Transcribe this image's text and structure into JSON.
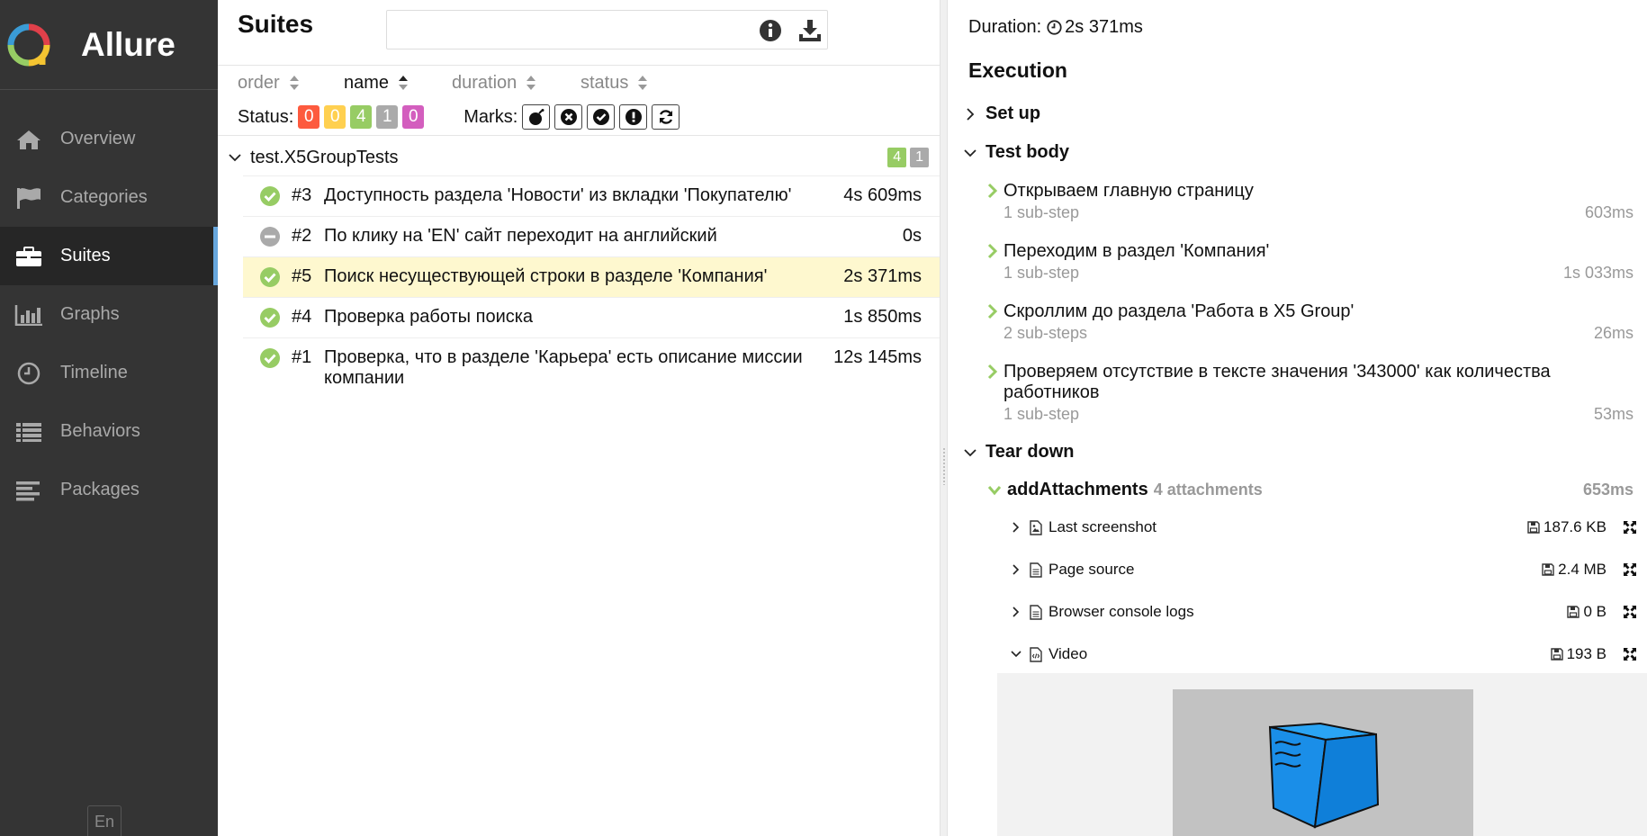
{
  "sidebar": {
    "brand": "Allure",
    "items": [
      {
        "label": "Overview",
        "icon": "home-icon"
      },
      {
        "label": "Categories",
        "icon": "flag-icon"
      },
      {
        "label": "Suites",
        "icon": "briefcase-icon",
        "active": true
      },
      {
        "label": "Graphs",
        "icon": "bar-chart-icon"
      },
      {
        "label": "Timeline",
        "icon": "clock-icon"
      },
      {
        "label": "Behaviors",
        "icon": "list-icon"
      },
      {
        "label": "Packages",
        "icon": "align-left-icon"
      }
    ],
    "language": "En"
  },
  "suites": {
    "title": "Suites",
    "search_placeholder": "",
    "sort": {
      "order": "order",
      "name": "name",
      "duration": "duration",
      "status": "status"
    },
    "status_label": "Status:",
    "status_counts": [
      {
        "value": "0",
        "color": "#fd5a3e"
      },
      {
        "value": "0",
        "color": "#ffd050"
      },
      {
        "value": "4",
        "color": "#97cc64"
      },
      {
        "value": "1",
        "color": "#aaaaaa"
      },
      {
        "value": "0",
        "color": "#d35ebe"
      }
    ],
    "marks_label": "Marks:",
    "marks": [
      "flaky-bomb-icon",
      "new-failed-icon",
      "new-passed-icon",
      "new-broken-icon",
      "retries-icon"
    ],
    "group": {
      "name": "test.X5GroupTests",
      "passed": "4",
      "skipped": "1"
    },
    "tests": [
      {
        "num": "#3",
        "name": "Доступность раздела 'Новости' из вкладки 'Покупателю'",
        "duration": "4s 609ms",
        "status": "passed"
      },
      {
        "num": "#2",
        "name": "По клику на 'EN' сайт переходит на английский",
        "duration": "0s",
        "status": "skipped"
      },
      {
        "num": "#5",
        "name": "Поиск несуществующей строки в разделе 'Компания'",
        "duration": "2s 371ms",
        "status": "passed",
        "selected": true
      },
      {
        "num": "#4",
        "name": "Проверка работы поиска",
        "duration": "1s 850ms",
        "status": "passed"
      },
      {
        "num": "#1",
        "name": "Проверка, что в разделе 'Карьера' есть описание миссии компании",
        "duration": "12s 145ms",
        "status": "passed"
      }
    ]
  },
  "details": {
    "duration_label": "Duration:",
    "duration_value": "2s 371ms",
    "execution_title": "Execution",
    "setup": "Set up",
    "test_body": "Test body",
    "steps": [
      {
        "title": "Открываем главную страницу",
        "sub": "1 sub-step",
        "duration": "603ms"
      },
      {
        "title": "Переходим в раздел 'Компания'",
        "sub": "1 sub-step",
        "duration": "1s 033ms"
      },
      {
        "title": "Скроллим до раздела 'Работа в X5 Group'",
        "sub": "2 sub-steps",
        "duration": "26ms"
      },
      {
        "title": "Проверяем отсутствие в тексте значения '343000' как количества работников",
        "sub": "1 sub-step",
        "duration": "53ms"
      }
    ],
    "teardown": "Tear down",
    "add_attachments": {
      "name": "addAttachments",
      "count": "4 attachments",
      "duration": "653ms"
    },
    "attachments": [
      {
        "name": "Last screenshot",
        "size": "187.6 KB",
        "icon": "image-file-icon",
        "expanded": false
      },
      {
        "name": "Page source",
        "size": "2.4 MB",
        "icon": "text-file-icon",
        "expanded": false
      },
      {
        "name": "Browser console logs",
        "size": "0 B",
        "icon": "text-file-icon",
        "expanded": false
      },
      {
        "name": "Video",
        "size": "193 B",
        "icon": "code-file-icon",
        "expanded": true
      }
    ]
  }
}
